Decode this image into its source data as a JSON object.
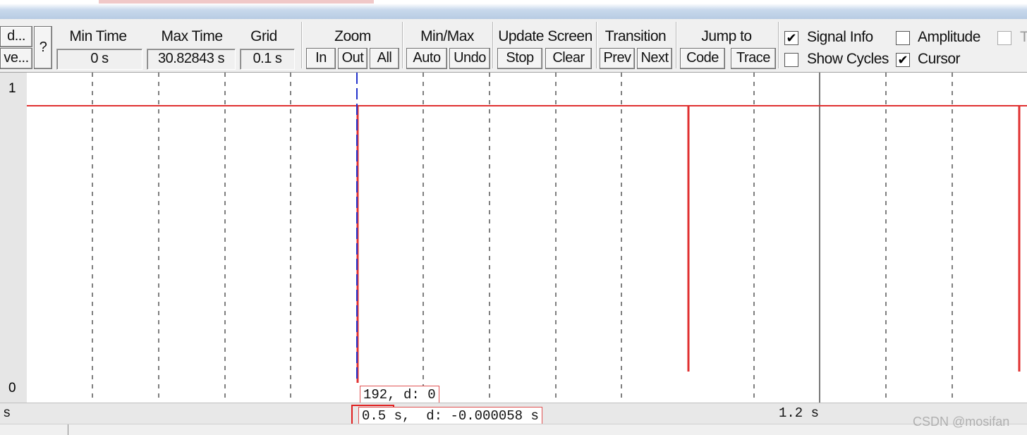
{
  "toolbar": {
    "left_buttons": [
      "d...",
      "ve...",
      "?"
    ],
    "min_time": {
      "label": "Min Time",
      "value": "0 s"
    },
    "max_time": {
      "label": "Max Time",
      "value": "30.82843 s"
    },
    "grid": {
      "label": "Grid",
      "value": "0.1 s"
    },
    "zoom": {
      "label": "Zoom",
      "in": "In",
      "out": "Out",
      "all": "All"
    },
    "minmax": {
      "label": "Min/Max",
      "auto": "Auto",
      "undo": "Undo"
    },
    "update_screen": {
      "label": "Update Screen",
      "stop": "Stop",
      "clear": "Clear"
    },
    "transition": {
      "label": "Transition",
      "prev": "Prev",
      "next": "Next"
    },
    "jump_to": {
      "label": "Jump to",
      "code": "Code",
      "trace": "Trace"
    },
    "options": {
      "signal_info": {
        "label": "Signal Info",
        "checked": true
      },
      "amplitude": {
        "label": "Amplitude",
        "checked": false
      },
      "show_cycles": {
        "label": "Show Cycles",
        "checked": false
      },
      "cursor": {
        "label": "Cursor",
        "checked": true
      },
      "truncated": {
        "label": "T",
        "checked": false
      }
    }
  },
  "analyzer": {
    "y_max_label": "1",
    "y_min_label": "0",
    "value_readout": "192,  d: 0",
    "time_readout_time": "0.5 s,",
    "time_readout_delta": "d: -0.000058 s",
    "axis_unit_left": "s",
    "axis_time_right": "1.2 s",
    "watermark": "CSDN @mosifan",
    "colors": {
      "signal": "#e03030",
      "cursor": "#2233cc",
      "grid": "#555555",
      "highlight": "#e02020"
    }
  }
}
